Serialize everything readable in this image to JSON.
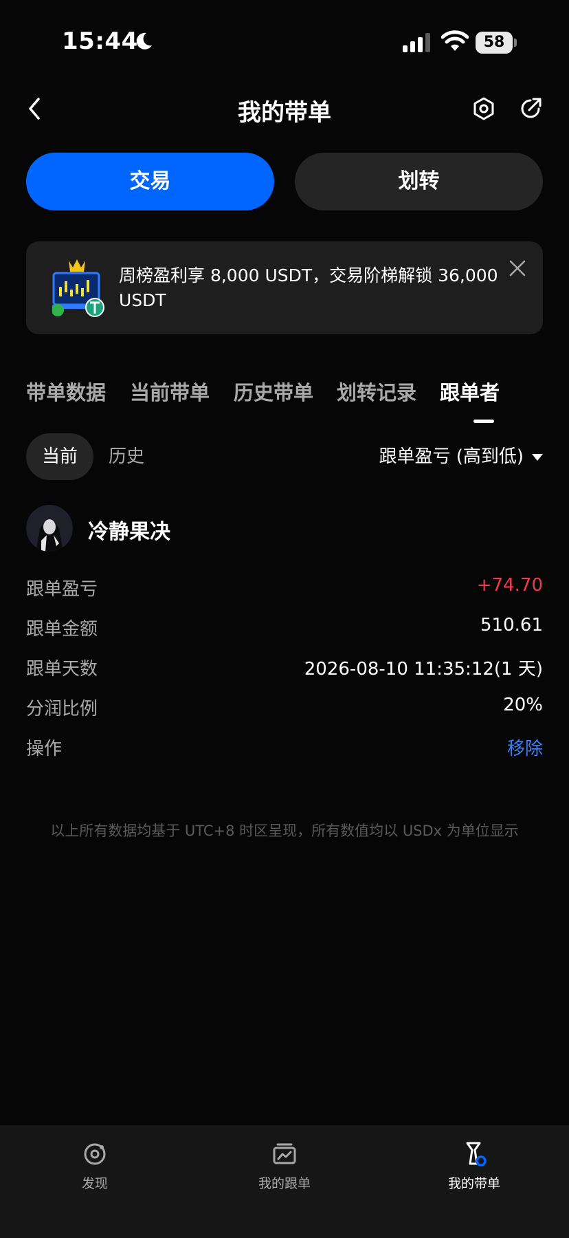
{
  "status_bar": {
    "time": "15:44",
    "battery": "58"
  },
  "header": {
    "title": "我的带单"
  },
  "actions": {
    "trade_label": "交易",
    "transfer_label": "划转"
  },
  "banner": {
    "text": "周榜盈利享 8,000 USDT，交易阶梯解锁 36,000 USDT"
  },
  "tabs": [
    {
      "label": "带单数据",
      "active": false
    },
    {
      "label": "当前带单",
      "active": false
    },
    {
      "label": "历史带单",
      "active": false
    },
    {
      "label": "划转记录",
      "active": false
    },
    {
      "label": "跟单者",
      "active": true
    }
  ],
  "filter": {
    "current_label": "当前",
    "history_label": "历史",
    "sort_label": "跟单盈亏 (高到低)"
  },
  "follower": {
    "name": "冷静果决",
    "rows": [
      {
        "label": "跟单盈亏",
        "value": "+74.70"
      },
      {
        "label": "跟单金额",
        "value": "510.61"
      },
      {
        "label": "跟单天数",
        "value": "2026-08-10 11:35:12(1 天)"
      },
      {
        "label": "分润比例",
        "value": "20%"
      },
      {
        "label": "操作",
        "value": "移除"
      }
    ]
  },
  "footnote": "以上所有数据均基于 UTC+8 时区呈现，所有数值均以 USDx 为单位显示",
  "bottom_nav": [
    {
      "label": "发现",
      "icon": "discover-icon",
      "active": false
    },
    {
      "label": "我的跟单",
      "icon": "copy-trade-icon",
      "active": false
    },
    {
      "label": "我的带单",
      "icon": "lead-trade-icon",
      "active": true
    }
  ],
  "colors": {
    "accent": "#0066ff",
    "profit": "#f23a4f",
    "link": "#3b7ff5",
    "background": "#060606"
  }
}
